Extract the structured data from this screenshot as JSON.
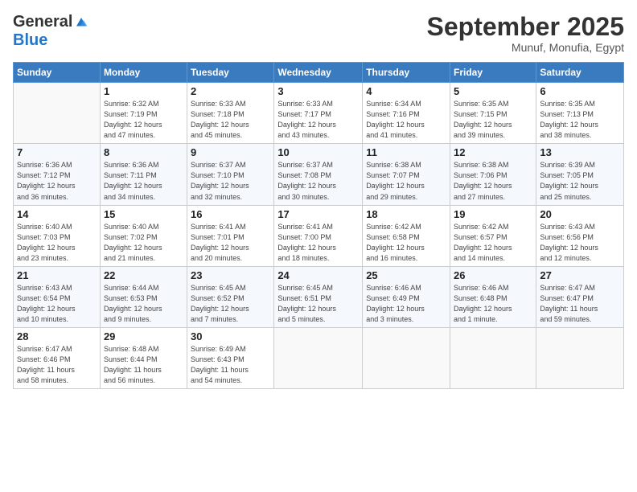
{
  "header": {
    "logo_general": "General",
    "logo_blue": "Blue",
    "month_title": "September 2025",
    "subtitle": "Munuf, Monufia, Egypt"
  },
  "weekdays": [
    "Sunday",
    "Monday",
    "Tuesday",
    "Wednesday",
    "Thursday",
    "Friday",
    "Saturday"
  ],
  "weeks": [
    [
      {
        "day": "",
        "info": ""
      },
      {
        "day": "1",
        "info": "Sunrise: 6:32 AM\nSunset: 7:19 PM\nDaylight: 12 hours\nand 47 minutes."
      },
      {
        "day": "2",
        "info": "Sunrise: 6:33 AM\nSunset: 7:18 PM\nDaylight: 12 hours\nand 45 minutes."
      },
      {
        "day": "3",
        "info": "Sunrise: 6:33 AM\nSunset: 7:17 PM\nDaylight: 12 hours\nand 43 minutes."
      },
      {
        "day": "4",
        "info": "Sunrise: 6:34 AM\nSunset: 7:16 PM\nDaylight: 12 hours\nand 41 minutes."
      },
      {
        "day": "5",
        "info": "Sunrise: 6:35 AM\nSunset: 7:15 PM\nDaylight: 12 hours\nand 39 minutes."
      },
      {
        "day": "6",
        "info": "Sunrise: 6:35 AM\nSunset: 7:13 PM\nDaylight: 12 hours\nand 38 minutes."
      }
    ],
    [
      {
        "day": "7",
        "info": "Sunrise: 6:36 AM\nSunset: 7:12 PM\nDaylight: 12 hours\nand 36 minutes."
      },
      {
        "day": "8",
        "info": "Sunrise: 6:36 AM\nSunset: 7:11 PM\nDaylight: 12 hours\nand 34 minutes."
      },
      {
        "day": "9",
        "info": "Sunrise: 6:37 AM\nSunset: 7:10 PM\nDaylight: 12 hours\nand 32 minutes."
      },
      {
        "day": "10",
        "info": "Sunrise: 6:37 AM\nSunset: 7:08 PM\nDaylight: 12 hours\nand 30 minutes."
      },
      {
        "day": "11",
        "info": "Sunrise: 6:38 AM\nSunset: 7:07 PM\nDaylight: 12 hours\nand 29 minutes."
      },
      {
        "day": "12",
        "info": "Sunrise: 6:38 AM\nSunset: 7:06 PM\nDaylight: 12 hours\nand 27 minutes."
      },
      {
        "day": "13",
        "info": "Sunrise: 6:39 AM\nSunset: 7:05 PM\nDaylight: 12 hours\nand 25 minutes."
      }
    ],
    [
      {
        "day": "14",
        "info": "Sunrise: 6:40 AM\nSunset: 7:03 PM\nDaylight: 12 hours\nand 23 minutes."
      },
      {
        "day": "15",
        "info": "Sunrise: 6:40 AM\nSunset: 7:02 PM\nDaylight: 12 hours\nand 21 minutes."
      },
      {
        "day": "16",
        "info": "Sunrise: 6:41 AM\nSunset: 7:01 PM\nDaylight: 12 hours\nand 20 minutes."
      },
      {
        "day": "17",
        "info": "Sunrise: 6:41 AM\nSunset: 7:00 PM\nDaylight: 12 hours\nand 18 minutes."
      },
      {
        "day": "18",
        "info": "Sunrise: 6:42 AM\nSunset: 6:58 PM\nDaylight: 12 hours\nand 16 minutes."
      },
      {
        "day": "19",
        "info": "Sunrise: 6:42 AM\nSunset: 6:57 PM\nDaylight: 12 hours\nand 14 minutes."
      },
      {
        "day": "20",
        "info": "Sunrise: 6:43 AM\nSunset: 6:56 PM\nDaylight: 12 hours\nand 12 minutes."
      }
    ],
    [
      {
        "day": "21",
        "info": "Sunrise: 6:43 AM\nSunset: 6:54 PM\nDaylight: 12 hours\nand 10 minutes."
      },
      {
        "day": "22",
        "info": "Sunrise: 6:44 AM\nSunset: 6:53 PM\nDaylight: 12 hours\nand 9 minutes."
      },
      {
        "day": "23",
        "info": "Sunrise: 6:45 AM\nSunset: 6:52 PM\nDaylight: 12 hours\nand 7 minutes."
      },
      {
        "day": "24",
        "info": "Sunrise: 6:45 AM\nSunset: 6:51 PM\nDaylight: 12 hours\nand 5 minutes."
      },
      {
        "day": "25",
        "info": "Sunrise: 6:46 AM\nSunset: 6:49 PM\nDaylight: 12 hours\nand 3 minutes."
      },
      {
        "day": "26",
        "info": "Sunrise: 6:46 AM\nSunset: 6:48 PM\nDaylight: 12 hours\nand 1 minute."
      },
      {
        "day": "27",
        "info": "Sunrise: 6:47 AM\nSunset: 6:47 PM\nDaylight: 11 hours\nand 59 minutes."
      }
    ],
    [
      {
        "day": "28",
        "info": "Sunrise: 6:47 AM\nSunset: 6:46 PM\nDaylight: 11 hours\nand 58 minutes."
      },
      {
        "day": "29",
        "info": "Sunrise: 6:48 AM\nSunset: 6:44 PM\nDaylight: 11 hours\nand 56 minutes."
      },
      {
        "day": "30",
        "info": "Sunrise: 6:49 AM\nSunset: 6:43 PM\nDaylight: 11 hours\nand 54 minutes."
      },
      {
        "day": "",
        "info": ""
      },
      {
        "day": "",
        "info": ""
      },
      {
        "day": "",
        "info": ""
      },
      {
        "day": "",
        "info": ""
      }
    ]
  ]
}
